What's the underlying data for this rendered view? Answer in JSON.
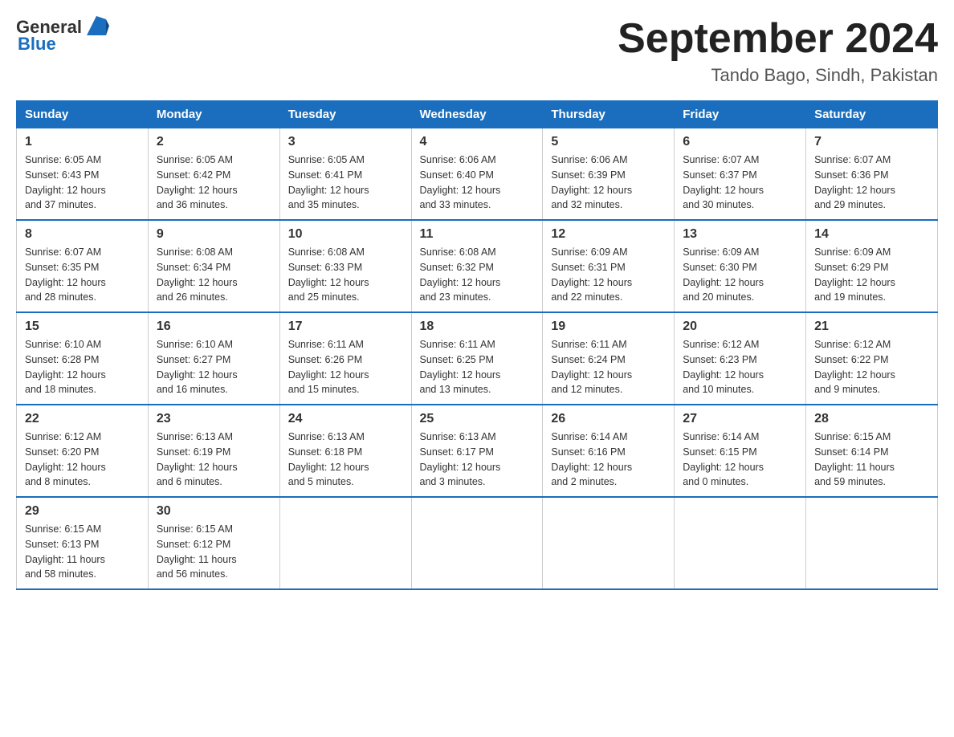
{
  "header": {
    "logo_general": "General",
    "logo_blue": "Blue",
    "title": "September 2024",
    "subtitle": "Tando Bago, Sindh, Pakistan"
  },
  "days_of_week": [
    "Sunday",
    "Monday",
    "Tuesday",
    "Wednesday",
    "Thursday",
    "Friday",
    "Saturday"
  ],
  "weeks": [
    [
      {
        "day": "1",
        "sunrise": "6:05 AM",
        "sunset": "6:43 PM",
        "daylight": "12 hours and 37 minutes."
      },
      {
        "day": "2",
        "sunrise": "6:05 AM",
        "sunset": "6:42 PM",
        "daylight": "12 hours and 36 minutes."
      },
      {
        "day": "3",
        "sunrise": "6:05 AM",
        "sunset": "6:41 PM",
        "daylight": "12 hours and 35 minutes."
      },
      {
        "day": "4",
        "sunrise": "6:06 AM",
        "sunset": "6:40 PM",
        "daylight": "12 hours and 33 minutes."
      },
      {
        "day": "5",
        "sunrise": "6:06 AM",
        "sunset": "6:39 PM",
        "daylight": "12 hours and 32 minutes."
      },
      {
        "day": "6",
        "sunrise": "6:07 AM",
        "sunset": "6:37 PM",
        "daylight": "12 hours and 30 minutes."
      },
      {
        "day": "7",
        "sunrise": "6:07 AM",
        "sunset": "6:36 PM",
        "daylight": "12 hours and 29 minutes."
      }
    ],
    [
      {
        "day": "8",
        "sunrise": "6:07 AM",
        "sunset": "6:35 PM",
        "daylight": "12 hours and 28 minutes."
      },
      {
        "day": "9",
        "sunrise": "6:08 AM",
        "sunset": "6:34 PM",
        "daylight": "12 hours and 26 minutes."
      },
      {
        "day": "10",
        "sunrise": "6:08 AM",
        "sunset": "6:33 PM",
        "daylight": "12 hours and 25 minutes."
      },
      {
        "day": "11",
        "sunrise": "6:08 AM",
        "sunset": "6:32 PM",
        "daylight": "12 hours and 23 minutes."
      },
      {
        "day": "12",
        "sunrise": "6:09 AM",
        "sunset": "6:31 PM",
        "daylight": "12 hours and 22 minutes."
      },
      {
        "day": "13",
        "sunrise": "6:09 AM",
        "sunset": "6:30 PM",
        "daylight": "12 hours and 20 minutes."
      },
      {
        "day": "14",
        "sunrise": "6:09 AM",
        "sunset": "6:29 PM",
        "daylight": "12 hours and 19 minutes."
      }
    ],
    [
      {
        "day": "15",
        "sunrise": "6:10 AM",
        "sunset": "6:28 PM",
        "daylight": "12 hours and 18 minutes."
      },
      {
        "day": "16",
        "sunrise": "6:10 AM",
        "sunset": "6:27 PM",
        "daylight": "12 hours and 16 minutes."
      },
      {
        "day": "17",
        "sunrise": "6:11 AM",
        "sunset": "6:26 PM",
        "daylight": "12 hours and 15 minutes."
      },
      {
        "day": "18",
        "sunrise": "6:11 AM",
        "sunset": "6:25 PM",
        "daylight": "12 hours and 13 minutes."
      },
      {
        "day": "19",
        "sunrise": "6:11 AM",
        "sunset": "6:24 PM",
        "daylight": "12 hours and 12 minutes."
      },
      {
        "day": "20",
        "sunrise": "6:12 AM",
        "sunset": "6:23 PM",
        "daylight": "12 hours and 10 minutes."
      },
      {
        "day": "21",
        "sunrise": "6:12 AM",
        "sunset": "6:22 PM",
        "daylight": "12 hours and 9 minutes."
      }
    ],
    [
      {
        "day": "22",
        "sunrise": "6:12 AM",
        "sunset": "6:20 PM",
        "daylight": "12 hours and 8 minutes."
      },
      {
        "day": "23",
        "sunrise": "6:13 AM",
        "sunset": "6:19 PM",
        "daylight": "12 hours and 6 minutes."
      },
      {
        "day": "24",
        "sunrise": "6:13 AM",
        "sunset": "6:18 PM",
        "daylight": "12 hours and 5 minutes."
      },
      {
        "day": "25",
        "sunrise": "6:13 AM",
        "sunset": "6:17 PM",
        "daylight": "12 hours and 3 minutes."
      },
      {
        "day": "26",
        "sunrise": "6:14 AM",
        "sunset": "6:16 PM",
        "daylight": "12 hours and 2 minutes."
      },
      {
        "day": "27",
        "sunrise": "6:14 AM",
        "sunset": "6:15 PM",
        "daylight": "12 hours and 0 minutes."
      },
      {
        "day": "28",
        "sunrise": "6:15 AM",
        "sunset": "6:14 PM",
        "daylight": "11 hours and 59 minutes."
      }
    ],
    [
      {
        "day": "29",
        "sunrise": "6:15 AM",
        "sunset": "6:13 PM",
        "daylight": "11 hours and 58 minutes."
      },
      {
        "day": "30",
        "sunrise": "6:15 AM",
        "sunset": "6:12 PM",
        "daylight": "11 hours and 56 minutes."
      },
      null,
      null,
      null,
      null,
      null
    ]
  ],
  "labels": {
    "sunrise": "Sunrise:",
    "sunset": "Sunset:",
    "daylight": "Daylight:"
  }
}
